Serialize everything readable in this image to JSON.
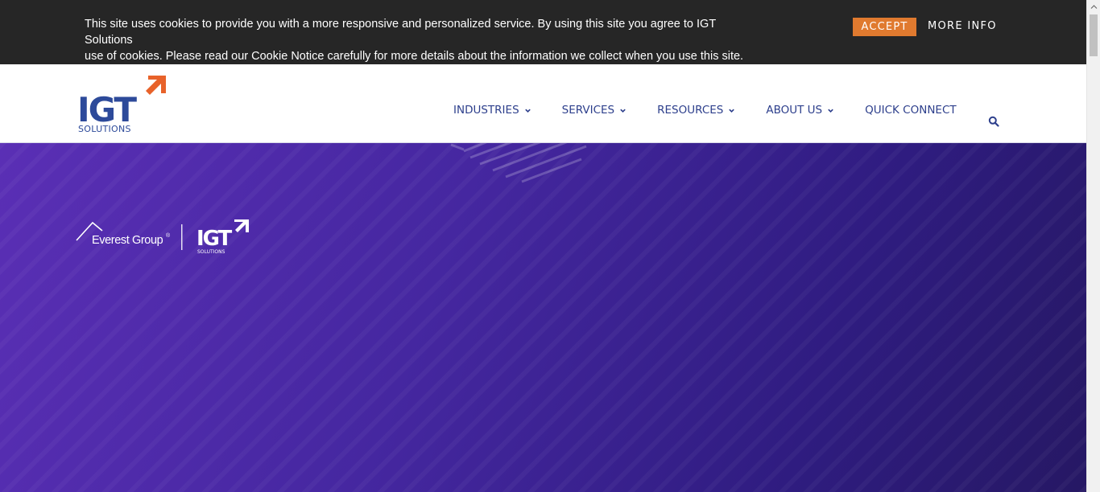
{
  "cookie_bar": {
    "text_line1": "This site uses cookies to provide you with a more responsive and personalized service. By using this site you agree to IGT Solutions",
    "text_line2": "use of cookies. Please read our Cookie Notice carefully for more details about the information we collect when you use this site.",
    "accept_label": "ACCEPT",
    "more_info_label": "MORE INFO"
  },
  "header": {
    "logo_text": "IGT",
    "logo_subtext": "SOLUTIONS",
    "nav": [
      {
        "label": "INDUSTRIES",
        "has_dropdown": true
      },
      {
        "label": "SERVICES",
        "has_dropdown": true
      },
      {
        "label": "RESOURCES",
        "has_dropdown": true
      },
      {
        "label": "ABOUT US",
        "has_dropdown": true
      },
      {
        "label": "QUICK CONNECT",
        "has_dropdown": false
      }
    ],
    "search_icon": "search-icon"
  },
  "hero": {
    "partner_logo_left": "Everest Group",
    "partner_logo_right": "IGT",
    "partner_logo_right_sub": "SOLUTIONS"
  },
  "colors": {
    "accent_orange": "#e07a2f",
    "nav_blue": "#2d3f8c",
    "hero_purple": "#4527a0",
    "cookie_bg": "#262626"
  }
}
